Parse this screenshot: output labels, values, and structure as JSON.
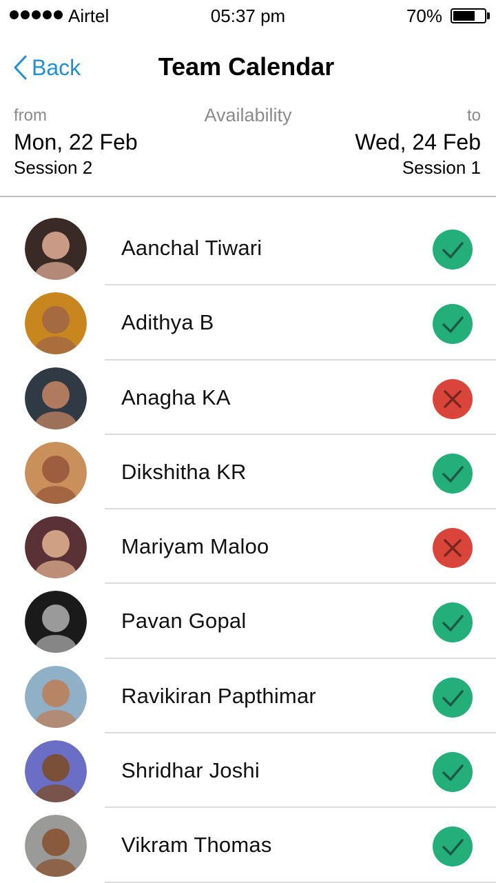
{
  "status_bar": {
    "carrier": "Airtel",
    "time": "05:37 pm",
    "battery_percent": "70%",
    "battery_level": 0.7
  },
  "nav": {
    "back_label": "Back",
    "title": "Team Calendar"
  },
  "range": {
    "from_label": "from",
    "availability_label": "Availability",
    "to_label": "to",
    "from_date": "Mon, 22 Feb",
    "from_session": "Session 2",
    "to_date": "Wed, 24 Feb",
    "to_session": "Session 1"
  },
  "colors": {
    "available": "#23ae7a",
    "unavailable": "#d9453a",
    "accent": "#1e90d8"
  },
  "members": [
    {
      "name": "Aanchal Tiwari",
      "available": true,
      "avatar_bg": "#3a2a26",
      "avatar_skin": "#c99a86"
    },
    {
      "name": "Adithya B",
      "available": true,
      "avatar_bg": "#c8861e",
      "avatar_skin": "#a56a42"
    },
    {
      "name": "Anagha KA",
      "available": false,
      "avatar_bg": "#2f3a44",
      "avatar_skin": "#b07a5e"
    },
    {
      "name": "Dikshitha KR",
      "available": true,
      "avatar_bg": "#c9905b",
      "avatar_skin": "#9c5e3e"
    },
    {
      "name": "Mariyam Maloo",
      "available": false,
      "avatar_bg": "#5a3236",
      "avatar_skin": "#d0a084"
    },
    {
      "name": "Pavan Gopal",
      "available": true,
      "avatar_bg": "#1a1a1a",
      "avatar_skin": "#9a9a9a"
    },
    {
      "name": "Ravikiran Papthimar",
      "available": true,
      "avatar_bg": "#8fb0c6",
      "avatar_skin": "#b68566"
    },
    {
      "name": "Shridhar Joshi",
      "available": true,
      "avatar_bg": "#6a6ec4",
      "avatar_skin": "#7a5038"
    },
    {
      "name": "Vikram Thomas",
      "available": true,
      "avatar_bg": "#9a9a98",
      "avatar_skin": "#8a5a3c"
    }
  ]
}
